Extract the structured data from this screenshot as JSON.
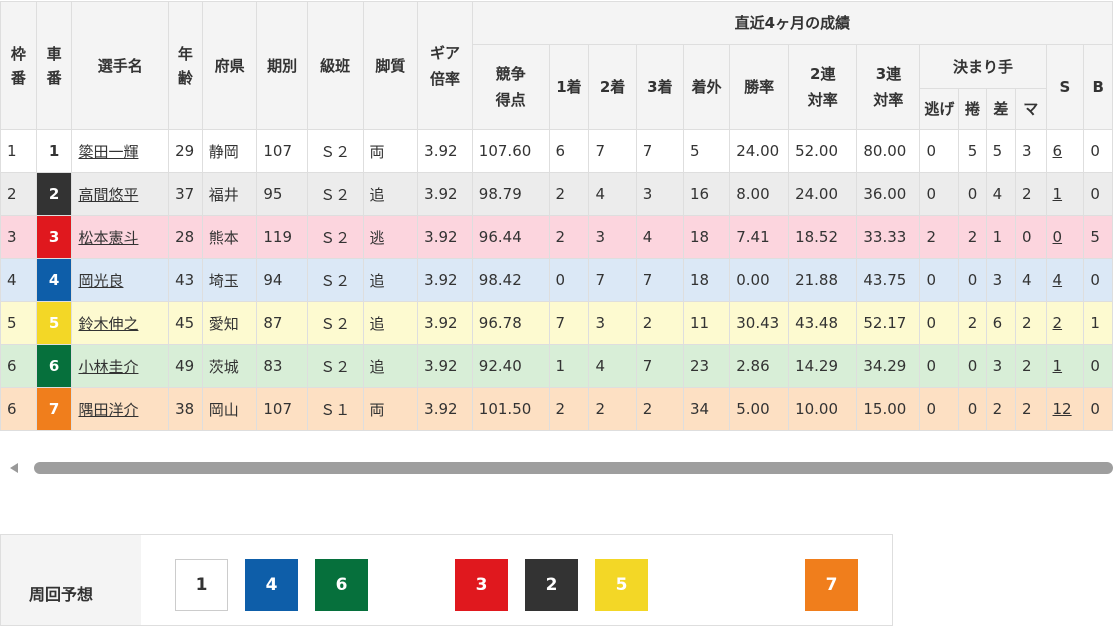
{
  "colors": {
    "1": "#ffffff",
    "2": "#333333",
    "3": "#e0181e",
    "4": "#0e5ea9",
    "5": "#f3d726",
    "6": "#06703c",
    "7": "#f07e1c",
    "row_bg": {
      "1": "#ffffff",
      "2": "#ececec",
      "3": "#fcd5de",
      "4": "#dbe8f6",
      "5": "#fdfad0",
      "6": "#d8eed7",
      "7": "#fde0c3"
    }
  },
  "table": {
    "headers": {
      "waku": "枠番",
      "sha": "車番",
      "name": "選手名",
      "age": "年齢",
      "pref": "府県",
      "term": "期別",
      "class": "級班",
      "leg": "脚質",
      "gear": "ギア倍率",
      "recent": "直近4ヶ月の成績",
      "score": "競争得点",
      "first": "1着",
      "second": "2着",
      "third": "3着",
      "out": "着外",
      "win_rate": "勝率",
      "quinella_rate": "2連対率",
      "trio_rate": "3連対率",
      "kimarite": "決まり手",
      "nige": "逃げ",
      "makuri": "捲",
      "sashi": "差",
      "mark": "マ",
      "s": "S",
      "b": "B"
    },
    "rows": [
      {
        "waku": "1",
        "sha": "1",
        "name": "簗田一輝",
        "age": "29",
        "pref": "静岡",
        "term": "107",
        "class": "Ｓ２",
        "leg": "両",
        "gear": "3.92",
        "score": "107.60",
        "first": "6",
        "second": "7",
        "third": "7",
        "out": "5",
        "win_rate": "24.00",
        "quinella_rate": "52.00",
        "trio_rate": "80.00",
        "nige": "0",
        "makuri": "5",
        "sashi": "5",
        "mark": "3",
        "s": "6",
        "b": "0"
      },
      {
        "waku": "2",
        "sha": "2",
        "name": "高間悠平",
        "age": "37",
        "pref": "福井",
        "term": "95",
        "class": "Ｓ２",
        "leg": "追",
        "gear": "3.92",
        "score": "98.79",
        "first": "2",
        "second": "4",
        "third": "3",
        "out": "16",
        "win_rate": "8.00",
        "quinella_rate": "24.00",
        "trio_rate": "36.00",
        "nige": "0",
        "makuri": "0",
        "sashi": "4",
        "mark": "2",
        "s": "1",
        "b": "0"
      },
      {
        "waku": "3",
        "sha": "3",
        "name": "松本憲斗",
        "age": "28",
        "pref": "熊本",
        "term": "119",
        "class": "Ｓ２",
        "leg": "逃",
        "gear": "3.92",
        "score": "96.44",
        "first": "2",
        "second": "3",
        "third": "4",
        "out": "18",
        "win_rate": "7.41",
        "quinella_rate": "18.52",
        "trio_rate": "33.33",
        "nige": "2",
        "makuri": "2",
        "sashi": "1",
        "mark": "0",
        "s": "0",
        "b": "5"
      },
      {
        "waku": "4",
        "sha": "4",
        "name": "岡光良",
        "age": "43",
        "pref": "埼玉",
        "term": "94",
        "class": "Ｓ２",
        "leg": "追",
        "gear": "3.92",
        "score": "98.42",
        "first": "0",
        "second": "7",
        "third": "7",
        "out": "18",
        "win_rate": "0.00",
        "quinella_rate": "21.88",
        "trio_rate": "43.75",
        "nige": "0",
        "makuri": "0",
        "sashi": "3",
        "mark": "4",
        "s": "4",
        "b": "0"
      },
      {
        "waku": "5",
        "sha": "5",
        "name": "鈴木伸之",
        "age": "45",
        "pref": "愛知",
        "term": "87",
        "class": "Ｓ２",
        "leg": "追",
        "gear": "3.92",
        "score": "96.78",
        "first": "7",
        "second": "3",
        "third": "2",
        "out": "11",
        "win_rate": "30.43",
        "quinella_rate": "43.48",
        "trio_rate": "52.17",
        "nige": "0",
        "makuri": "2",
        "sashi": "6",
        "mark": "2",
        "s": "2",
        "b": "1"
      },
      {
        "waku": "6",
        "sha": "6",
        "name": "小林圭介",
        "age": "49",
        "pref": "茨城",
        "term": "83",
        "class": "Ｓ２",
        "leg": "追",
        "gear": "3.92",
        "score": "92.40",
        "first": "1",
        "second": "4",
        "third": "7",
        "out": "23",
        "win_rate": "2.86",
        "quinella_rate": "14.29",
        "trio_rate": "34.29",
        "nige": "0",
        "makuri": "0",
        "sashi": "3",
        "mark": "2",
        "s": "1",
        "b": "0"
      },
      {
        "waku": "6",
        "sha": "7",
        "name": "隅田洋介",
        "age": "38",
        "pref": "岡山",
        "term": "107",
        "class": "Ｓ１",
        "leg": "両",
        "gear": "3.92",
        "score": "101.50",
        "first": "2",
        "second": "2",
        "third": "2",
        "out": "34",
        "win_rate": "5.00",
        "quinella_rate": "10.00",
        "trio_rate": "15.00",
        "nige": "0",
        "makuri": "0",
        "sashi": "2",
        "mark": "2",
        "s": "12",
        "b": "0"
      }
    ]
  },
  "prediction": {
    "label": "周回予想",
    "boxes": [
      "1",
      "4",
      "6",
      "3",
      "2",
      "5",
      "7"
    ]
  }
}
